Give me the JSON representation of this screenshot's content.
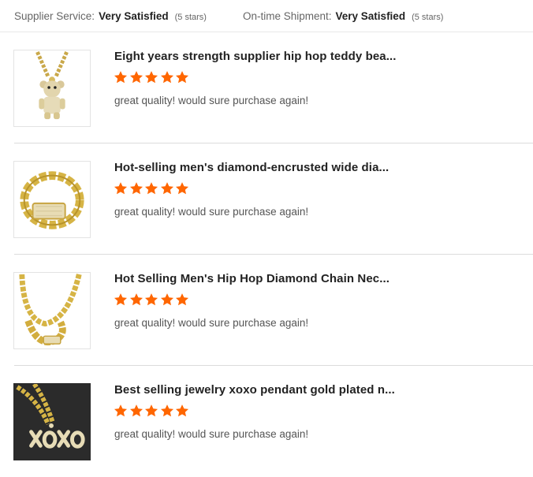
{
  "summary": {
    "supplier_label": "Supplier Service:",
    "supplier_value": "Very Satisfied",
    "supplier_stars": "(5 stars)",
    "shipment_label": "On-time Shipment:",
    "shipment_value": "Very Satisfied",
    "shipment_stars": "(5 stars)"
  },
  "colors": {
    "star": "#ff6600",
    "divider": "#dcdcdc"
  },
  "reviews": [
    {
      "title": "Eight years strength supplier hip hop teddy bea...",
      "rating": 5,
      "comment": "great quality! would sure purchase again!",
      "image_icon": "teddy-bear-pendant-icon"
    },
    {
      "title": "Hot-selling men's diamond-encrusted wide dia...",
      "rating": 5,
      "comment": "great quality! would sure purchase again!",
      "image_icon": "cuban-bracelet-icon"
    },
    {
      "title": "Hot Selling Men's Hip Hop Diamond Chain Nec...",
      "rating": 5,
      "comment": "great quality! would sure purchase again!",
      "image_icon": "chain-necklace-icon"
    },
    {
      "title": "Best selling jewelry xoxo pendant gold plated n...",
      "rating": 5,
      "comment": "great quality! would sure purchase again!",
      "image_icon": "xoxo-pendant-icon"
    }
  ]
}
